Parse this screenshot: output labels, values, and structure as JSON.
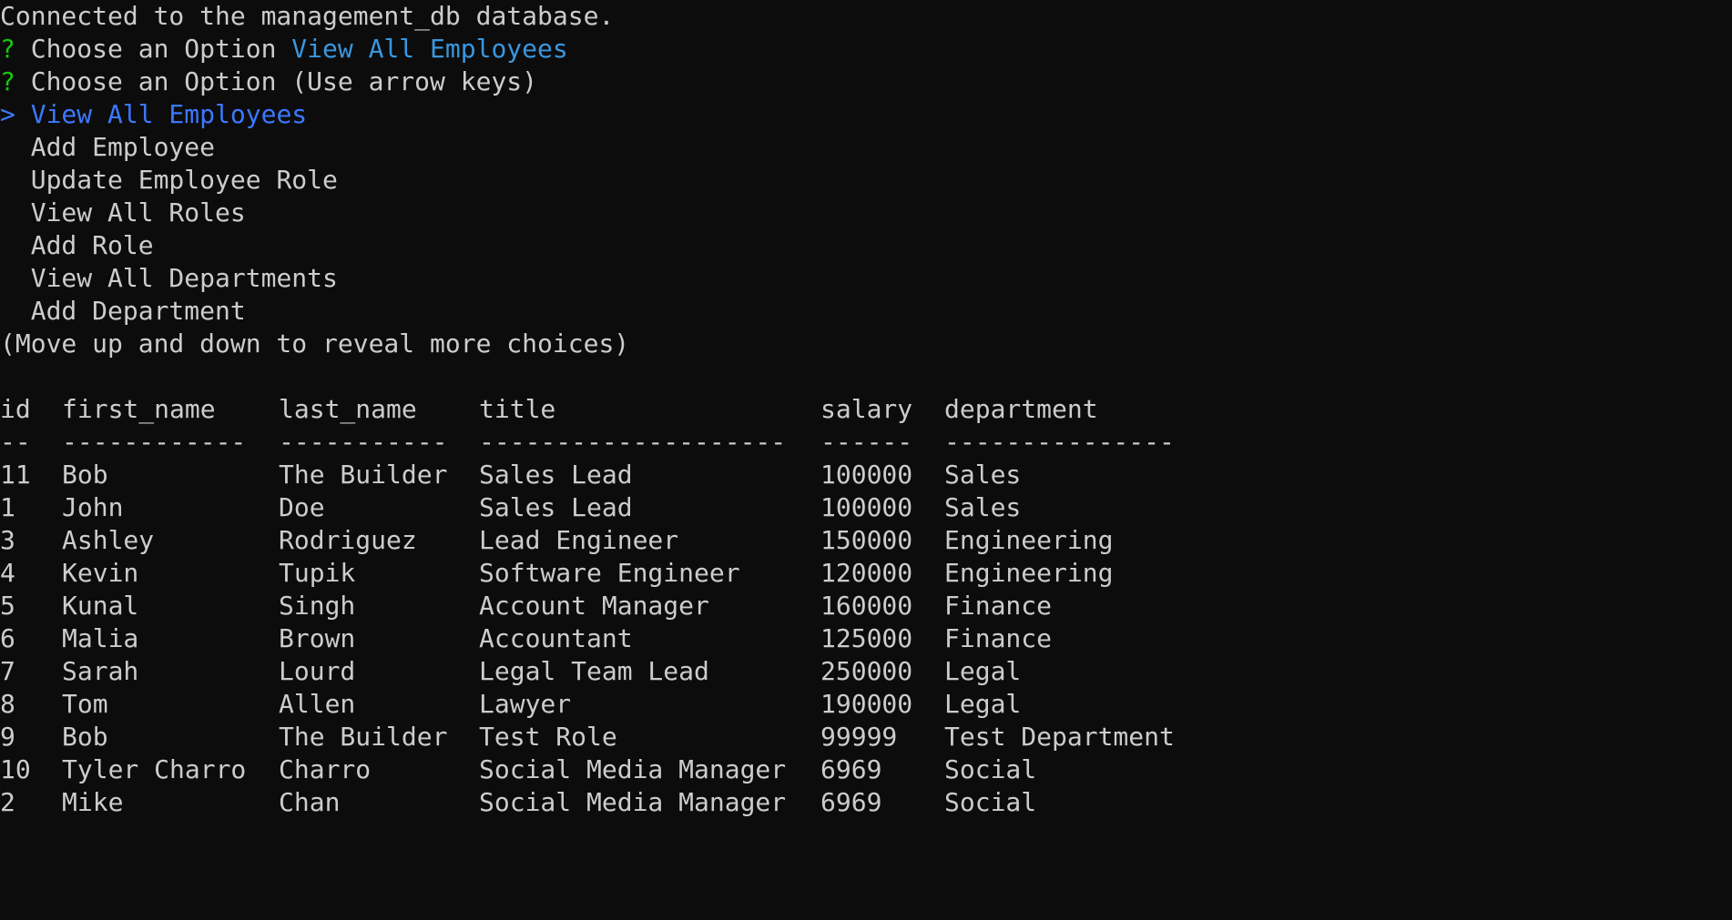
{
  "terminal": {
    "status": "Connected to the management_db database.",
    "first_prompt": {
      "marker": "?",
      "question": "Choose an Option",
      "answer": "View All Employees"
    },
    "second_prompt": {
      "marker": "?",
      "question": "Choose an Option",
      "hint": "(Use arrow keys)"
    },
    "menu": {
      "pointer": ">",
      "items": [
        "View All Employees",
        "Add Employee",
        "Update Employee Role",
        "View All Roles",
        "Add Role",
        "View All Departments",
        "Add Department"
      ],
      "selected_index": 0,
      "more_hint": "(Move up and down to reveal more choices)"
    },
    "table": {
      "headers": [
        "id",
        "first_name",
        "last_name",
        "title",
        "salary",
        "department"
      ],
      "separators": [
        "--",
        "------------",
        "-----------",
        "--------------------",
        "------",
        "---------------"
      ],
      "rows": [
        [
          "11",
          "Bob",
          "The Builder",
          "Sales Lead",
          "100000",
          "Sales"
        ],
        [
          "1",
          "John",
          "Doe",
          "Sales Lead",
          "100000",
          "Sales"
        ],
        [
          "3",
          "Ashley",
          "Rodriguez",
          "Lead Engineer",
          "150000",
          "Engineering"
        ],
        [
          "4",
          "Kevin",
          "Tupik",
          "Software Engineer",
          "120000",
          "Engineering"
        ],
        [
          "5",
          "Kunal",
          "Singh",
          "Account Manager",
          "160000",
          "Finance"
        ],
        [
          "6",
          "Malia",
          "Brown",
          "Accountant",
          "125000",
          "Finance"
        ],
        [
          "7",
          "Sarah",
          "Lourd",
          "Legal Team Lead",
          "250000",
          "Legal"
        ],
        [
          "8",
          "Tom",
          "Allen",
          "Lawyer",
          "190000",
          "Legal"
        ],
        [
          "9",
          "Bob",
          "The Builder",
          "Test Role",
          "99999",
          "Test Department"
        ],
        [
          "10",
          "Tyler Charro",
          "Charro",
          "Social Media Manager",
          "6969",
          "Social"
        ],
        [
          "2",
          "Mike",
          "Chan",
          "Social Media Manager",
          "6969",
          "Social"
        ]
      ]
    }
  }
}
